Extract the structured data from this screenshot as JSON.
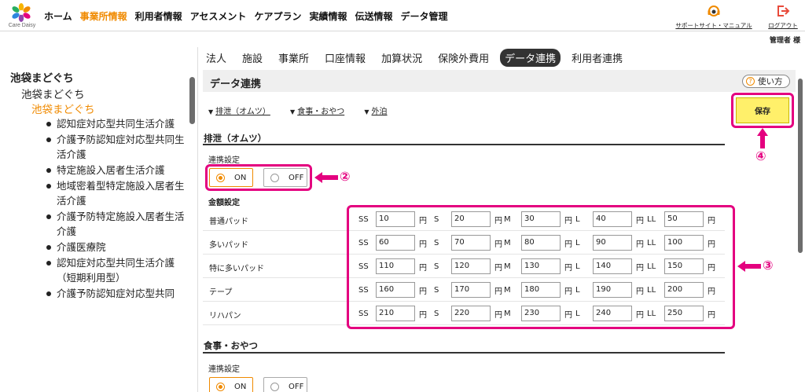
{
  "header": {
    "brand": "Care Daisy",
    "nav": [
      "ホーム",
      "事業所情報",
      "利用者情報",
      "アセスメント",
      "ケアプラン",
      "実績情報",
      "伝送情報",
      "データ管理"
    ],
    "active_nav": "事業所情報",
    "support_label": "サポートサイト・マニュアル",
    "logout_label": "ログアウト",
    "user_label": "管理者 様"
  },
  "sidebar": {
    "root": "池袋まどぐち",
    "level2": "池袋まどぐち",
    "level3": "池袋まどぐち",
    "services": [
      "認知症対応型共同生活介護",
      "介護予防認知症対応型共同生活介護",
      "特定施設入居者生活介護",
      "地域密着型特定施設入居者生活介護",
      "介護予防特定施設入居者生活介護",
      "介護医療院",
      "認知症対応型共同生活介護（短期利用型）",
      "介護予防認知症対応型共同"
    ]
  },
  "tabs": {
    "items": [
      "法人",
      "施設",
      "事業所",
      "口座情報",
      "加算状況",
      "保険外費用",
      "データ連携",
      "利用者連携"
    ],
    "active": "データ連携"
  },
  "main": {
    "section_title": "データ連携",
    "usage_label": "使い方",
    "usage_icon": "?",
    "anchors": [
      "排泄（オムツ）",
      "食事・おやつ",
      "外泊"
    ],
    "save_label": "保存",
    "excretion": {
      "title": "排泄（オムツ）",
      "link_setting_label": "連携設定",
      "on_label": "ON",
      "off_label": "OFF",
      "selected": "ON",
      "amount_label": "金額設定",
      "sizes": [
        "SS",
        "S",
        "M",
        "L",
        "LL"
      ],
      "unit": "円",
      "rows": [
        {
          "name": "普通パッド",
          "values": [
            "10",
            "20",
            "30",
            "40",
            "50"
          ]
        },
        {
          "name": "多いパッド",
          "values": [
            "60",
            "70",
            "80",
            "90",
            "100"
          ]
        },
        {
          "name": "特に多いパッド",
          "values": [
            "110",
            "120",
            "130",
            "140",
            "150"
          ]
        },
        {
          "name": "テープ",
          "values": [
            "160",
            "170",
            "180",
            "190",
            "200"
          ]
        },
        {
          "name": "リハパン",
          "values": [
            "210",
            "220",
            "230",
            "240",
            "250"
          ]
        }
      ]
    },
    "meal": {
      "title": "食事・おやつ",
      "link_setting_label": "連携設定",
      "on_label": "ON",
      "off_label": "OFF"
    }
  },
  "annotations": {
    "two": "②",
    "three": "③",
    "four": "④",
    "color": "#e4007f"
  },
  "colors": {
    "accent": "#f08a00",
    "highlight": "#e4007f",
    "save": "#fff06a"
  }
}
